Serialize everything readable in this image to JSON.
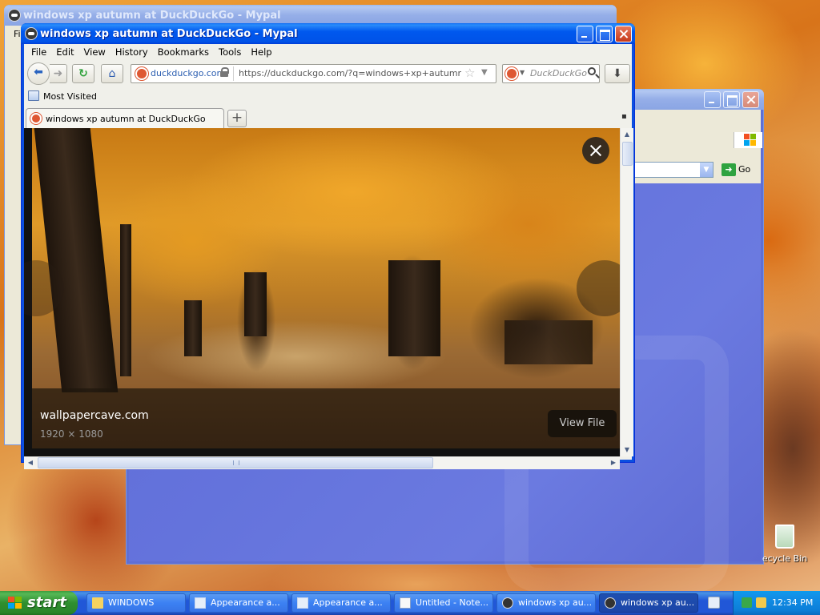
{
  "windows": {
    "background_title": "windows xp autumn at DuckDuckGo - Mypal",
    "bg_menu_fragment": "Fil",
    "ie_go_label": "Go"
  },
  "main": {
    "title": "windows xp autumn at DuckDuckGo - Mypal",
    "menu": [
      "File",
      "Edit",
      "View",
      "History",
      "Bookmarks",
      "Tools",
      "Help"
    ],
    "identity_label": "duckduckgo.com",
    "url": "https://duckduckgo.com/?q=windows+xp+autumn&t=pal",
    "search_placeholder": "DuckDuckGo",
    "bookmarks_label": "Most Visited",
    "tab_title": "windows xp autumn at DuckDuckGo",
    "image_source": "wallpapercave.com",
    "image_dimensions": "1920 × 1080",
    "view_file_label": "View File"
  },
  "desktop": {
    "recycle_label": "ecycle Bin"
  },
  "taskbar": {
    "start_label": "start",
    "buttons": [
      {
        "label": "WINDOWS",
        "icon": "folder-icon"
      },
      {
        "label": "Appearance a...",
        "icon": "display-icon"
      },
      {
        "label": "Appearance a...",
        "icon": "display-icon"
      },
      {
        "label": "Untitled - Note...",
        "icon": "notepad-icon"
      },
      {
        "label": "windows xp au...",
        "icon": "mypal-icon"
      },
      {
        "label": "windows xp au...",
        "icon": "mypal-icon"
      }
    ],
    "clock": "12:34 PM"
  },
  "colors": {
    "xp_title_blue": "#0058ee",
    "start_green": "#2f8f2f",
    "taskbar_blue": "#2157d7",
    "tray_blue": "#0c9bec",
    "ddg_orange": "#de5833"
  }
}
